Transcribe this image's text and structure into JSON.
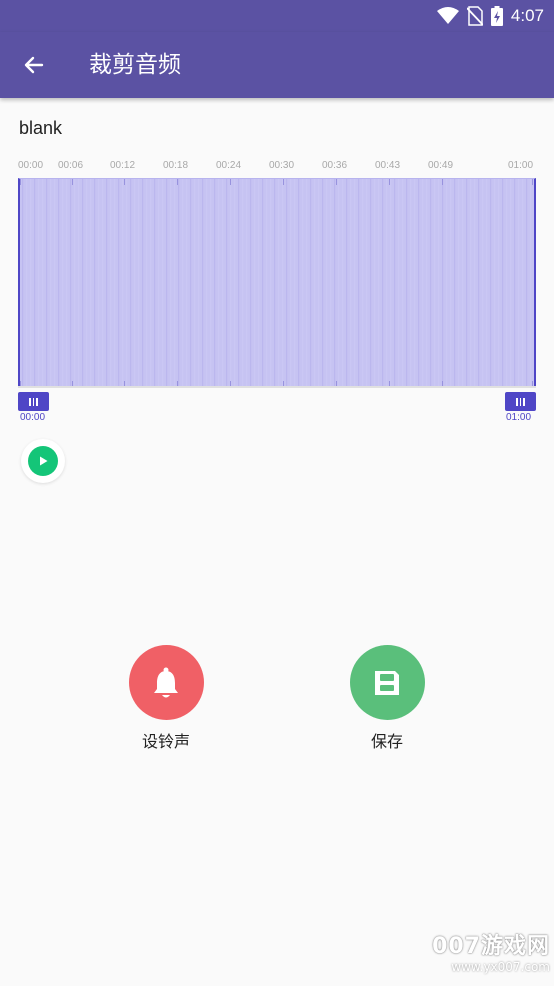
{
  "status_bar": {
    "time": "4:07",
    "icons": [
      "wifi-icon",
      "no-sim-icon",
      "battery-charging-icon"
    ]
  },
  "app_bar": {
    "title": "裁剪音频",
    "back_icon": "arrow-left-icon"
  },
  "file": {
    "name": "blank"
  },
  "timeline": {
    "ticks": [
      "00:00",
      "00:06",
      "00:12",
      "00:18",
      "00:24",
      "00:30",
      "00:36",
      "00:43",
      "00:49",
      "01:00"
    ],
    "selection_start": "00:00",
    "selection_end": "01:00"
  },
  "player": {
    "play_icon": "play-icon"
  },
  "actions": {
    "ringtone_label": "设铃声",
    "ringtone_icon": "bell-icon",
    "save_label": "保存",
    "save_icon": "floppy-disk-icon"
  },
  "watermark": {
    "line1": "007游戏网",
    "line2": "www.yx007.com"
  },
  "colors": {
    "primary": "#5b52a3",
    "accent": "#4f46c6",
    "waveform": "#c6c3f2",
    "play": "#14c578",
    "ringtone": "#f06066",
    "save": "#5abf7b"
  }
}
